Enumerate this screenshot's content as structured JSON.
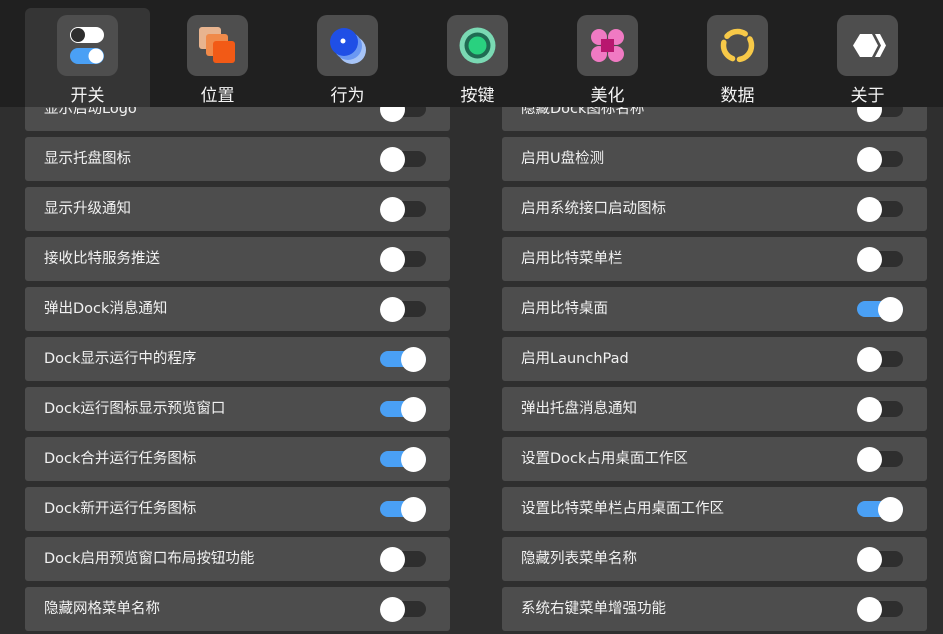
{
  "tabs": [
    {
      "label": "开关",
      "icon": "switch-icon",
      "active": true
    },
    {
      "label": "位置",
      "icon": "layers-icon",
      "active": false
    },
    {
      "label": "行为",
      "icon": "bubble-icon",
      "active": false
    },
    {
      "label": "按键",
      "icon": "ring-button-icon",
      "active": false
    },
    {
      "label": "美化",
      "icon": "flower-icon",
      "active": false
    },
    {
      "label": "数据",
      "icon": "circle-segments-icon",
      "active": false
    },
    {
      "label": "关于",
      "icon": "hexagon-chevron-icon",
      "active": false
    }
  ],
  "left_settings": [
    {
      "label": "显示启动Logo",
      "on": false
    },
    {
      "label": "显示托盘图标",
      "on": false
    },
    {
      "label": "显示升级通知",
      "on": false
    },
    {
      "label": "接收比特服务推送",
      "on": false
    },
    {
      "label": "弹出Dock消息通知",
      "on": false
    },
    {
      "label": "Dock显示运行中的程序",
      "on": true
    },
    {
      "label": "Dock运行图标显示预览窗口",
      "on": true
    },
    {
      "label": "Dock合并运行任务图标",
      "on": true
    },
    {
      "label": "Dock新开运行任务图标",
      "on": true
    },
    {
      "label": "Dock启用预览窗口布局按钮功能",
      "on": false
    },
    {
      "label": "隐藏网格菜单名称",
      "on": false
    }
  ],
  "right_settings": [
    {
      "label": "隐藏Dock图标名称",
      "on": false
    },
    {
      "label": "启用U盘检测",
      "on": false
    },
    {
      "label": "启用系统接口启动图标",
      "on": false
    },
    {
      "label": "启用比特菜单栏",
      "on": false
    },
    {
      "label": "启用比特桌面",
      "on": true
    },
    {
      "label": "启用LaunchPad",
      "on": false
    },
    {
      "label": "弹出托盘消息通知",
      "on": false
    },
    {
      "label": "设置Dock占用桌面工作区",
      "on": false
    },
    {
      "label": "设置比特菜单栏占用桌面工作区",
      "on": true
    },
    {
      "label": "隐藏列表菜单名称",
      "on": false
    },
    {
      "label": "系统右键菜单增强功能",
      "on": false
    }
  ],
  "colors": {
    "toggle_on": "#4aa0f5",
    "toggle_off": "#2e2e2e",
    "row_bg": "#4d4d4d",
    "tabbar_bg": "#202020"
  }
}
